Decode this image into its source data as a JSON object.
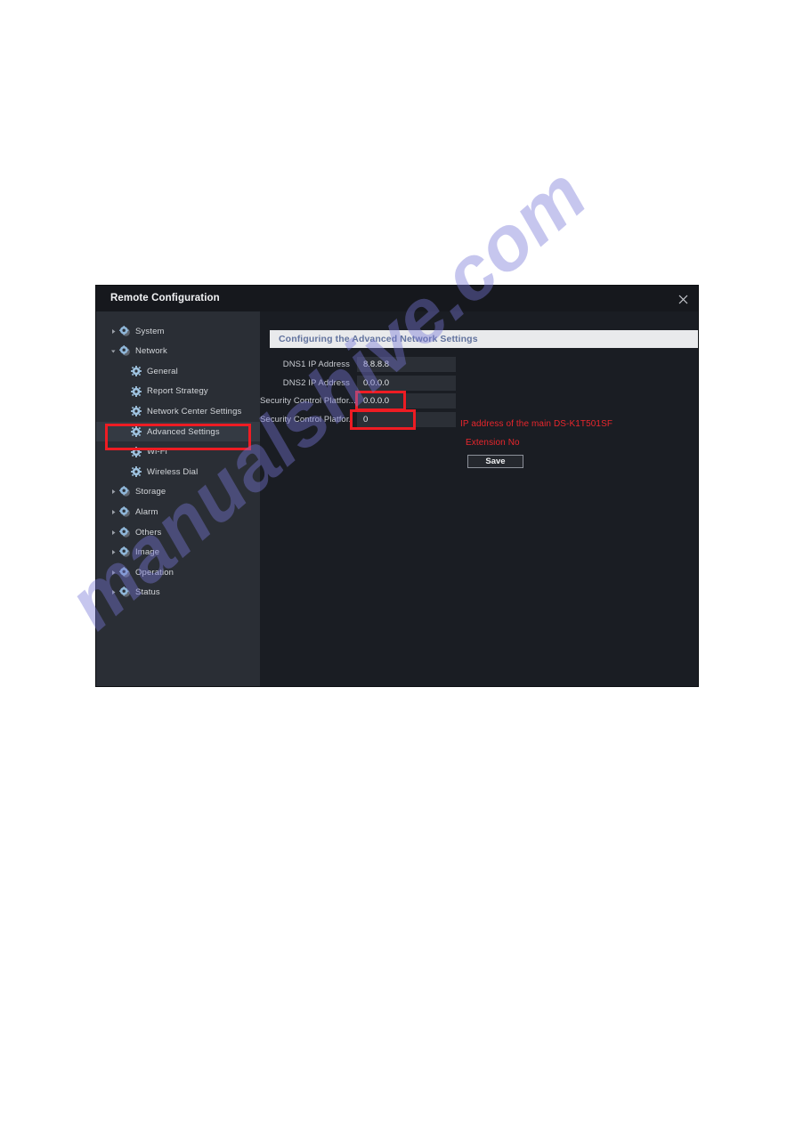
{
  "window": {
    "title": "Remote Configuration",
    "close_icon": "close-icon"
  },
  "sidebar": {
    "items": [
      {
        "label": "System",
        "level": 0,
        "expanded": false,
        "icon": "gear-sphere-icon",
        "arrow": "triangle-right"
      },
      {
        "label": "Network",
        "level": 0,
        "expanded": true,
        "icon": "gear-sphere-icon",
        "arrow": "triangle-down"
      },
      {
        "label": "General",
        "level": 1,
        "expanded": null,
        "icon": "gear-icon",
        "arrow": ""
      },
      {
        "label": "Report Strategy",
        "level": 1,
        "expanded": null,
        "icon": "gear-icon",
        "arrow": ""
      },
      {
        "label": "Network Center Settings",
        "level": 1,
        "expanded": null,
        "icon": "gear-icon",
        "arrow": ""
      },
      {
        "label": "Advanced Settings",
        "level": 1,
        "expanded": null,
        "icon": "gear-icon",
        "arrow": "",
        "selected": true
      },
      {
        "label": "Wi-Fi",
        "level": 1,
        "expanded": null,
        "icon": "gear-icon",
        "arrow": ""
      },
      {
        "label": "Wireless Dial",
        "level": 1,
        "expanded": null,
        "icon": "gear-icon",
        "arrow": ""
      },
      {
        "label": "Storage",
        "level": 0,
        "expanded": false,
        "icon": "gear-sphere-icon",
        "arrow": "triangle-right"
      },
      {
        "label": "Alarm",
        "level": 0,
        "expanded": false,
        "icon": "gear-sphere-icon",
        "arrow": "triangle-right"
      },
      {
        "label": "Others",
        "level": 0,
        "expanded": false,
        "icon": "gear-sphere-icon",
        "arrow": "triangle-right"
      },
      {
        "label": "Image",
        "level": 0,
        "expanded": false,
        "icon": "gear-sphere-icon",
        "arrow": "triangle-right"
      },
      {
        "label": "Operation",
        "level": 0,
        "expanded": false,
        "icon": "gear-sphere-icon",
        "arrow": "triangle-right"
      },
      {
        "label": "Status",
        "level": 0,
        "expanded": false,
        "icon": "gear-sphere-icon",
        "arrow": "triangle-right"
      }
    ]
  },
  "content": {
    "banner": "Configuring the Advanced Network Settings",
    "fields": [
      {
        "label": "DNS1 IP Address",
        "value": "8.8.8.8",
        "highlighted": false
      },
      {
        "label": "DNS2 IP Address",
        "value": "0.0.0.0",
        "highlighted": false
      },
      {
        "label": "Security Control Platfor...",
        "value": "0.0.0.0",
        "highlighted": true
      },
      {
        "label": "Security Control Platfor.",
        "value": "0",
        "highlighted": true
      }
    ],
    "save_label": "Save"
  },
  "annotations": [
    {
      "text": "IP address of the main DS-K1T501SF"
    },
    {
      "text": "Extension No"
    }
  ],
  "watermark": {
    "text": "manualshive.com"
  },
  "colors": {
    "accent_red": "#ee1c23",
    "annotation_red": "#e8262c",
    "banner_text": "#62739e",
    "sidebar_bg": "#2a2e35",
    "content_bg": "#1a1d23",
    "titlebar_bg": "#16181d",
    "watermark": "#7678d6"
  }
}
